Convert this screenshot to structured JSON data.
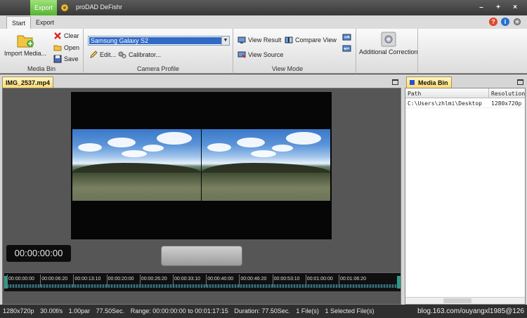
{
  "window": {
    "quick_tab": "Export",
    "title": "proDAD DeFishr",
    "controls": [
      "–",
      "+",
      "×"
    ]
  },
  "ribbon_tabs": [
    {
      "label": "Start",
      "active": true
    },
    {
      "label": "Export",
      "active": false
    }
  ],
  "media_bin_group": {
    "label": "Media Bin",
    "import": "Import Media...",
    "clear": "Clear",
    "open": "Open",
    "save": "Save"
  },
  "camera_profile_group": {
    "label": "Camera Profile",
    "selected": "Samsung Galaxy S2",
    "edit": "Edit...",
    "calibrator": "Calibrator..."
  },
  "view_mode_group": {
    "label": "View Mode",
    "view_result": "View Result",
    "compare_view": "Compare View",
    "view_source": "View Source"
  },
  "extra_group": {
    "additional_correction": "Additional Correction"
  },
  "preview": {
    "tab": "IMG_2537.mp4",
    "timecode": "00:00:00:00"
  },
  "timeline": {
    "ticks": [
      "00:00:00:00",
      "00:00:06:20",
      "00:00:13:10",
      "00:00:20:00",
      "00:00:26:20",
      "00:00:33:10",
      "00:00:40:00",
      "00:00:46:20",
      "00:00:53:10",
      "00:01:00:00",
      "00:01:06:20"
    ]
  },
  "media_bin": {
    "tab": "Media Bin",
    "columns": [
      "Path",
      "Resolution"
    ],
    "rows": [
      {
        "path": "C:\\Users\\zhlmi\\Desktop",
        "resolution": "1280x720p"
      }
    ]
  },
  "status": {
    "resolution": "1280x720p",
    "fps": "30.00f/s",
    "par": "1.00par",
    "length": "77.50Sec.",
    "range": "Range: 00:00:00:00 to 00:01:17:15",
    "duration": "Duration: 77.50Sec.",
    "files": "1 File(s)",
    "selected": "1 Selected File(s)"
  },
  "watermark": "blog.163.com/ouyangxl1985@126",
  "colors": {
    "accent_green": "#56b433",
    "selection_blue": "#3169c6",
    "tab_gold": "#ffd969"
  }
}
